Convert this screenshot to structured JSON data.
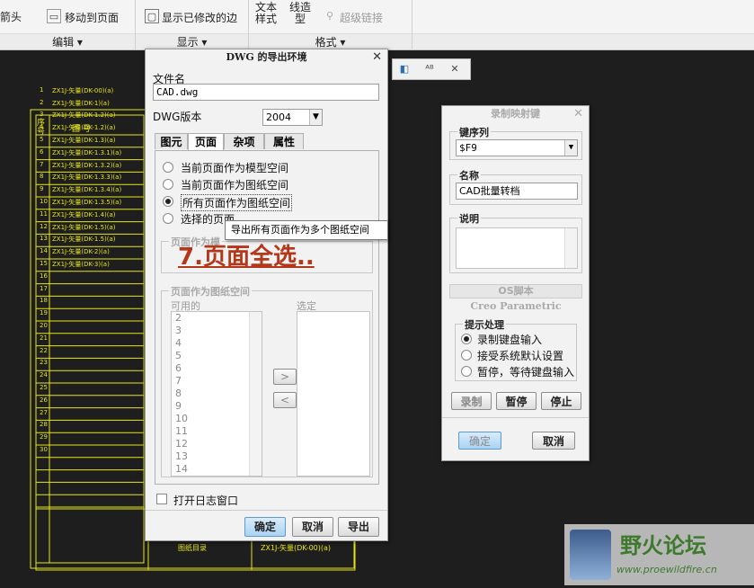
{
  "ribbon": {
    "arrow_fragment": "箭头",
    "move_to_page": "移动到页面",
    "show_modified_edges": "显示已修改的边",
    "text_style": [
      "文本",
      "样式"
    ],
    "line_style": [
      "线造",
      "型"
    ],
    "hyperlink": "超级链接",
    "groups": [
      "编辑 ▾",
      "显示 ▾",
      "格式 ▾"
    ]
  },
  "export_dialog": {
    "title": "DWG 的导出环境",
    "file_name_label": "文件名",
    "file_name_value": "CAD.dwg",
    "dwg_version_label": "DWG版本",
    "dwg_version_value": "2004",
    "tabs": [
      "图元",
      "页面",
      "杂项",
      "属性"
    ],
    "radio_options": [
      "当前页面作为模型空间",
      "当前页面作为图纸空间",
      "所有页面作为图纸空间",
      "选择的页面"
    ],
    "selected_index": 2,
    "tooltip": "导出所有页面作为多个图纸空间",
    "overlay_text": "7.页面全选..",
    "section_model_title": "页面作为模",
    "section_paper_title": "页面作为图纸空间",
    "available_label": "可用的",
    "selected_label": "选定",
    "available_pages": [
      "2",
      "3",
      "4",
      "5",
      "6",
      "7",
      "8",
      "9",
      "10",
      "11",
      "12",
      "13",
      "14"
    ],
    "open_log_label": "打开日志窗口",
    "ok": "确定",
    "cancel": "取消",
    "export": "导出"
  },
  "mapkey_dialog": {
    "title": "录制映射键",
    "key_sequence_label": "键序列",
    "key_sequence_value": "$F9",
    "name_label": "名称",
    "name_value": "CAD批量转档",
    "description_label": "说明",
    "os_script_label": "OS脚本",
    "creo_label": "Creo Parametric",
    "prompt_handling_label": "提示处理",
    "prompt_options": [
      "录制键盘输入",
      "接受系统默认设置",
      "暂停，等待键盘输入"
    ],
    "prompt_selected_index": 0,
    "record": "录制",
    "pause": "暂停",
    "stop": "停止",
    "ok": "确定",
    "cancel": "取消"
  },
  "drawing": {
    "table_header": [
      "序号",
      "图 号"
    ],
    "rows": [
      "ZX1J-矢量(DK-00)(a)",
      "ZX1J-矢量(DK-1)(a)",
      "ZX1J-矢量(DK-1.2)(a)",
      "ZX1J-矢量(DK-1.2)(a)",
      "ZX1J-矢量(DK-1.3)(a)",
      "ZX1J-矢量(DK-1.3.1)(a)",
      "ZX1J-矢量(DK-1.3.2)(a)",
      "ZX1J-矢量(DK-1.3.3)(a)",
      "ZX1J-矢量(DK-1.3.4)(a)",
      "ZX1J-矢量(DK-1.3.5)(a)",
      "ZX1J-矢量(DK-1.4)(a)",
      "ZX1J-矢量(DK-1.5)(a)",
      "ZX1J-矢量(DK-1.5)(a)",
      "ZX1J-矢量(DK-2)(a)",
      "ZX1J-矢量(DK-3)(a)"
    ],
    "title_block": "图纸目录",
    "title_code": "ZX1J-矢量(DK-00)(a)",
    "watermark_title": "野火论坛",
    "watermark_url": "www.proewildfire.cn"
  },
  "colors": {
    "drawing_lines": "#e5e51a",
    "canvas": "#1e1e1e",
    "overlay": "#b5371a"
  }
}
